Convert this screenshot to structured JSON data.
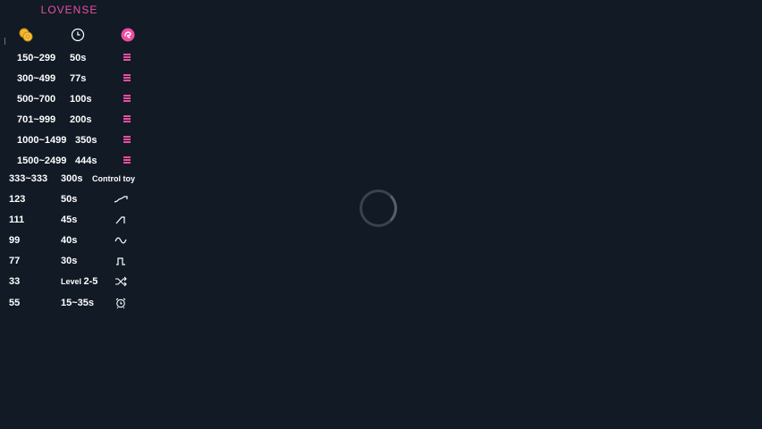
{
  "brand": {
    "logo_text": "LOVENSE",
    "accent_color": "#ec4ea1"
  },
  "header": {
    "coins_icon": "coins-icon",
    "time_icon": "clock-icon",
    "toy_icon": "lovense-toy-icon"
  },
  "level_rows": [
    {
      "amount": "150~299",
      "time": "50s",
      "icon": "vibration-level-icon"
    },
    {
      "amount": "300~499",
      "time": "77s",
      "icon": "vibration-level-icon"
    },
    {
      "amount": "500~700",
      "time": "100s",
      "icon": "vibration-level-icon"
    },
    {
      "amount": "701~999",
      "time": "200s",
      "icon": "vibration-level-icon"
    },
    {
      "amount": "1000~1499",
      "time": "350s",
      "icon": "vibration-level-icon"
    },
    {
      "amount": "1500~2499",
      "time": "444s",
      "icon": "vibration-level-icon"
    }
  ],
  "special_rows": [
    {
      "amount": "333~333",
      "time": "300s",
      "action": "Control toy"
    },
    {
      "amount": "123",
      "time": "50s",
      "icon": "wave-pattern-icon"
    },
    {
      "amount": "111",
      "time": "45s",
      "icon": "pulse-up-pattern-icon"
    },
    {
      "amount": "99",
      "time": "40s",
      "icon": "sine-pattern-icon"
    },
    {
      "amount": "77",
      "time": "30s",
      "icon": "square-pulse-pattern-icon"
    },
    {
      "amount": "33",
      "time_prefix": "Level",
      "time": "2-5",
      "icon": "shuffle-icon"
    },
    {
      "amount": "55",
      "time": "15~35s",
      "icon": "alarm-clock-icon"
    }
  ],
  "loading": {
    "icon": "loading-spinner"
  }
}
